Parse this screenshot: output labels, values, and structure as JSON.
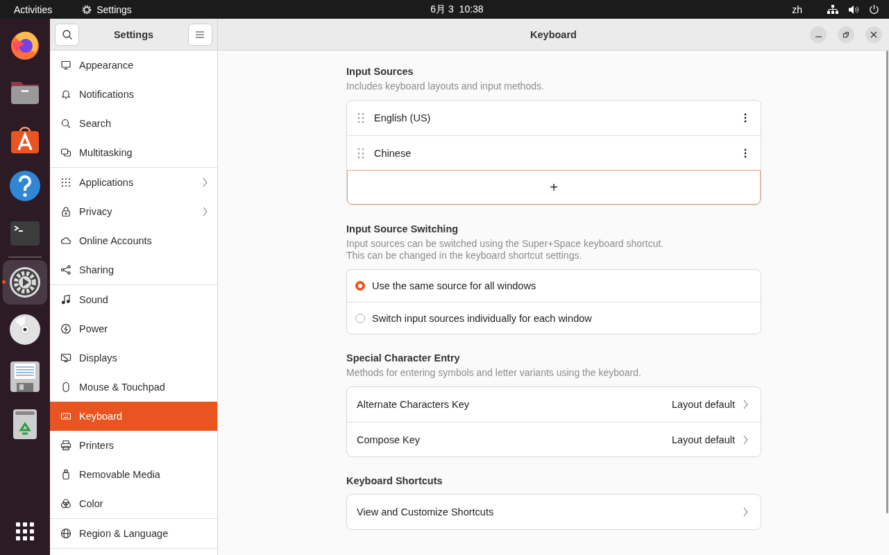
{
  "top_bar": {
    "activities": "Activities",
    "app_menu": "Settings",
    "clock": "6月 3  10:38",
    "input_method": "zh"
  },
  "dock": [
    {
      "active": false
    },
    {
      "active": false
    },
    {
      "active": false
    },
    {
      "active": false
    },
    {
      "active": false
    },
    {
      "active": true
    },
    {
      "active": false
    },
    {
      "active": false
    },
    {
      "active": false
    }
  ],
  "window": {
    "sidebar_title": "Settings",
    "title": "Keyboard"
  },
  "sidebar": {
    "groups": [
      [
        {
          "label": "Appearance",
          "has_submenu": false,
          "selected": false
        },
        {
          "label": "Notifications",
          "has_submenu": false,
          "selected": false
        },
        {
          "label": "Search",
          "has_submenu": false,
          "selected": false
        },
        {
          "label": "Multitasking",
          "has_submenu": false,
          "selected": false
        }
      ],
      [
        {
          "label": "Applications",
          "has_submenu": true,
          "selected": false
        },
        {
          "label": "Privacy",
          "has_submenu": true,
          "selected": false
        },
        {
          "label": "Online Accounts",
          "has_submenu": false,
          "selected": false
        },
        {
          "label": "Sharing",
          "has_submenu": false,
          "selected": false
        }
      ],
      [
        {
          "label": "Sound",
          "has_submenu": false,
          "selected": false
        },
        {
          "label": "Power",
          "has_submenu": false,
          "selected": false
        },
        {
          "label": "Displays",
          "has_submenu": false,
          "selected": false
        },
        {
          "label": "Mouse & Touchpad",
          "has_submenu": false,
          "selected": false
        },
        {
          "label": "Keyboard",
          "has_submenu": false,
          "selected": true
        },
        {
          "label": "Printers",
          "has_submenu": false,
          "selected": false
        },
        {
          "label": "Removable Media",
          "has_submenu": false,
          "selected": false
        },
        {
          "label": "Color",
          "has_submenu": false,
          "selected": false
        }
      ],
      [
        {
          "label": "Region & Language",
          "has_submenu": false,
          "selected": false
        }
      ]
    ]
  },
  "input_sources": {
    "title": "Input Sources",
    "description": "Includes keyboard layouts and input methods.",
    "sources": [
      {
        "name": "English (US)"
      },
      {
        "name": "Chinese"
      }
    ],
    "add_button": "+"
  },
  "input_source_switching": {
    "title": "Input Source Switching",
    "description_lines": [
      "Input sources can be switched using the Super+Space keyboard shortcut.",
      "This can be changed in the keyboard shortcut settings."
    ],
    "options": [
      {
        "label": "Use the same source for all windows",
        "selected": true
      },
      {
        "label": "Switch input sources individually for each window",
        "selected": false
      }
    ]
  },
  "special_character_entry": {
    "title": "Special Character Entry",
    "description": "Methods for entering symbols and letter variants using the keyboard.",
    "rows": [
      {
        "label": "Alternate Characters Key",
        "value": "Layout default"
      },
      {
        "label": "Compose Key",
        "value": "Layout default"
      }
    ]
  },
  "keyboard_shortcuts": {
    "title": "Keyboard Shortcuts",
    "rows": [
      {
        "label": "View and Customize Shortcuts"
      }
    ]
  }
}
